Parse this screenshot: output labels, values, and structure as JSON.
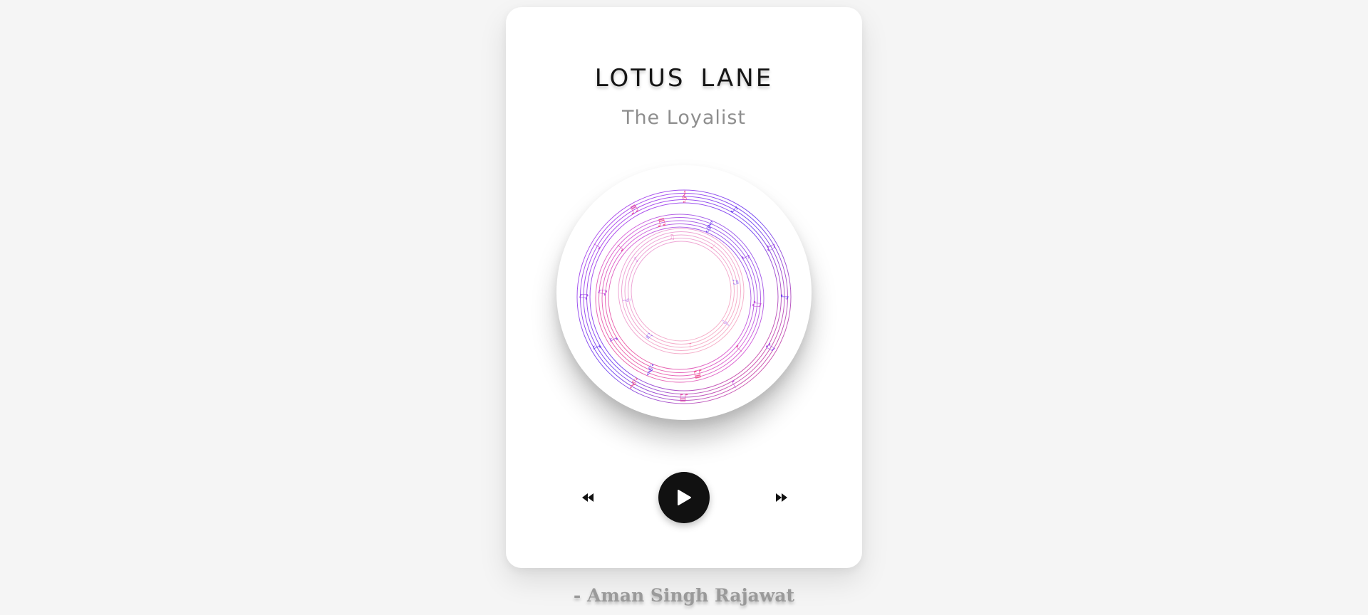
{
  "song": {
    "title": "LOTUS  LANE",
    "artist": "The Loyalist"
  },
  "artwork": {
    "icon": "music-notes-circle",
    "colors": {
      "outer": "#6a3cf0",
      "middle": "#c04ad8",
      "inner": "#f0508c"
    }
  },
  "controls": {
    "previous_icon": "rewind-icon",
    "play_icon": "play-icon",
    "next_icon": "fast-forward-icon",
    "play_button_color": "#111111"
  },
  "footer": {
    "credit": "- Aman Singh Rajawat"
  }
}
